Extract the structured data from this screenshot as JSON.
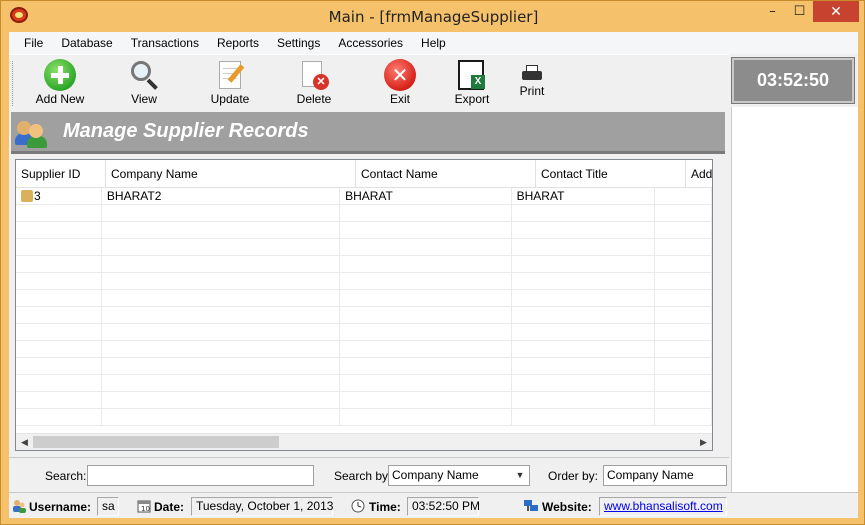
{
  "window": {
    "title": "Main - [frmManageSupplier]",
    "minimize": "–",
    "maximize": "☐",
    "close": "✕"
  },
  "menu": [
    "File",
    "Database",
    "Transactions",
    "Reports",
    "Settings",
    "Accessories",
    "Help"
  ],
  "toolbar": {
    "add_new": "Add New",
    "view": "View",
    "update": "Update",
    "delete": "Delete",
    "exit": "Exit",
    "export": "Export",
    "print": "Print"
  },
  "clock": "03:52:50",
  "header": {
    "title": "Manage Supplier Records"
  },
  "grid": {
    "columns": [
      "Supplier ID",
      "Company Name",
      "Contact Name",
      "Contact Title",
      "Add"
    ],
    "rows": [
      [
        "3",
        "BHARAT2",
        "BHARAT",
        "BHARAT",
        ""
      ]
    ]
  },
  "search": {
    "search_label": "Search:",
    "search_value": "",
    "search_by_label": "Search by:",
    "search_by_value": "Company Name",
    "order_by_label": "Order by:",
    "order_by_value": "Company Name"
  },
  "status": {
    "username_label": "Username:",
    "username_value": "sa",
    "date_label": "Date:",
    "date_value": "Tuesday, October 1, 2013",
    "time_label": "Time:",
    "time_value": "03:52:50 PM",
    "website_label": "Website:",
    "website_value": "www.bhansalisoft.com"
  },
  "colors": {
    "frame": "#f5c26b",
    "header_band": "#a0a0a0",
    "clock_bg": "#8c8c8c",
    "close_button": "#c7432f"
  }
}
